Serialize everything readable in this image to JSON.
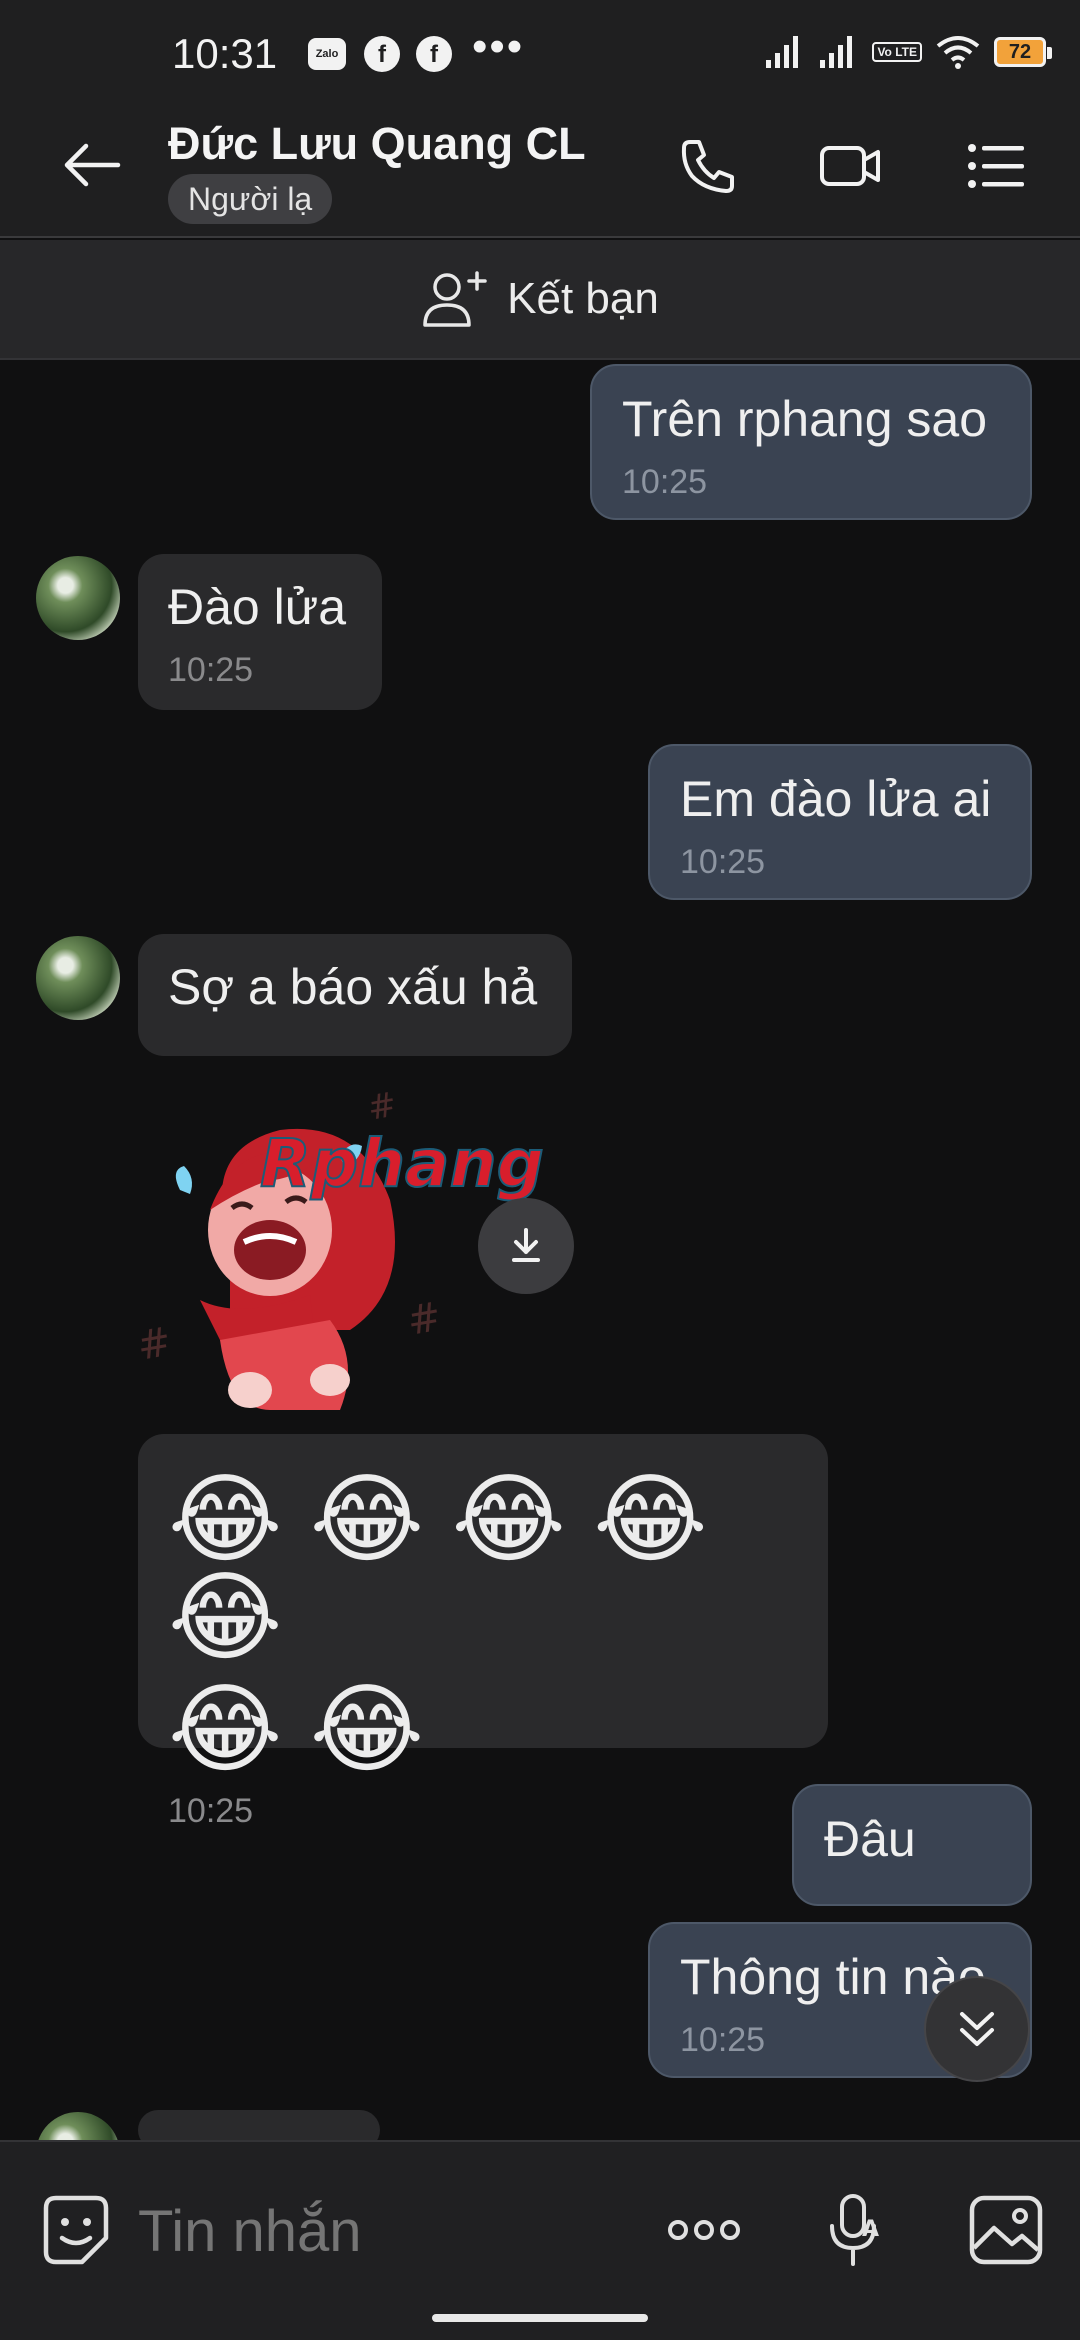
{
  "status_bar": {
    "time": "10:31",
    "zalo_label": "Zalo",
    "app_icons": [
      "facebook-icon",
      "facebook-icon"
    ],
    "overflow": "•••",
    "volte_label": "Vo LTE",
    "battery_level": "72"
  },
  "header": {
    "contact_name": "Đức Lưu Quang CL",
    "badge": "Người lạ",
    "icons": [
      "back-arrow-icon",
      "phone-icon",
      "video-call-icon",
      "menu-list-icon"
    ]
  },
  "add_friend": {
    "label": "Kết bạn",
    "icon": "add-friend-icon"
  },
  "messages": [
    {
      "direction": "out",
      "text": "Trên rphang sao",
      "time": "10:25"
    },
    {
      "direction": "in",
      "text": "Đào lửa",
      "time": "10:25"
    },
    {
      "direction": "out",
      "text": "Em đào lửa ai",
      "time": "10:25"
    },
    {
      "direction": "in",
      "text": "Sợ a báo xấu hả"
    },
    {
      "direction": "in",
      "type": "sticker",
      "watermark": "Rphang"
    },
    {
      "direction": "in",
      "type": "emoji",
      "emoji_row_1": "😂 😂 😂 😂 😂",
      "emoji_row_2": "😂 😂",
      "time": "10:25"
    },
    {
      "direction": "out",
      "text": "Đâu"
    },
    {
      "direction": "out",
      "text": "Thông tin nào",
      "time": "10:25"
    }
  ],
  "composer": {
    "placeholder": "Tin nhắn",
    "icons": [
      "sticker-icon",
      "more-icon",
      "voice-icon",
      "image-icon"
    ]
  },
  "colors": {
    "background": "#101011",
    "header": "#1F1F20",
    "outgoing_bubble": "#3A4352",
    "incoming_bubble": "#2A2A2C",
    "battery": "#F2A23A"
  }
}
